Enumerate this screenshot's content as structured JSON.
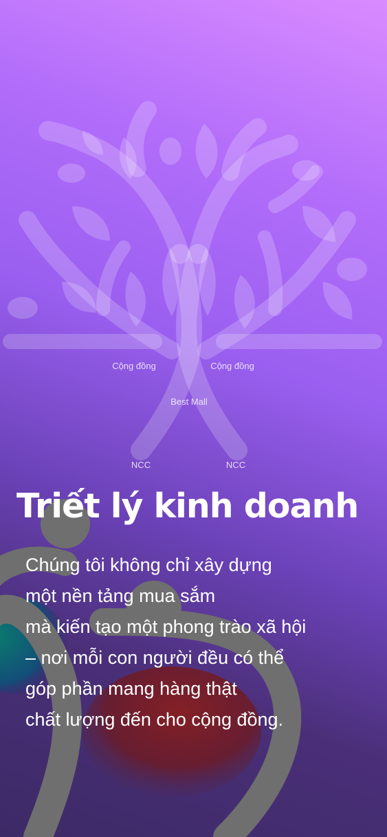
{
  "tree": {
    "labels": {
      "community_left": "Cộng đồng",
      "community_right": "Cộng đồng",
      "center": "Best Mall",
      "supplier_left": "NCC",
      "supplier_right": "NCC"
    }
  },
  "content": {
    "title": "Triết lý kinh doanh",
    "lines": [
      "Chúng tôi không chỉ xây dựng",
      "một nền tảng mua sắm",
      "mà kiến tạo một phong trào xã hội",
      "– nơi mỗi con người đều có thể",
      "góp phần mang hàng thật",
      "chất lượng đến cho cộng đồng."
    ]
  },
  "colors": {
    "gradient_top": "#d98bff",
    "gradient_mid": "#9a5ff0",
    "gradient_bottom": "#3c2a66",
    "ring_gray": "#6f6f6f",
    "blob_red": "#7a1f1f",
    "blob_teal": "#0b6e70",
    "text": "#ffffff"
  }
}
